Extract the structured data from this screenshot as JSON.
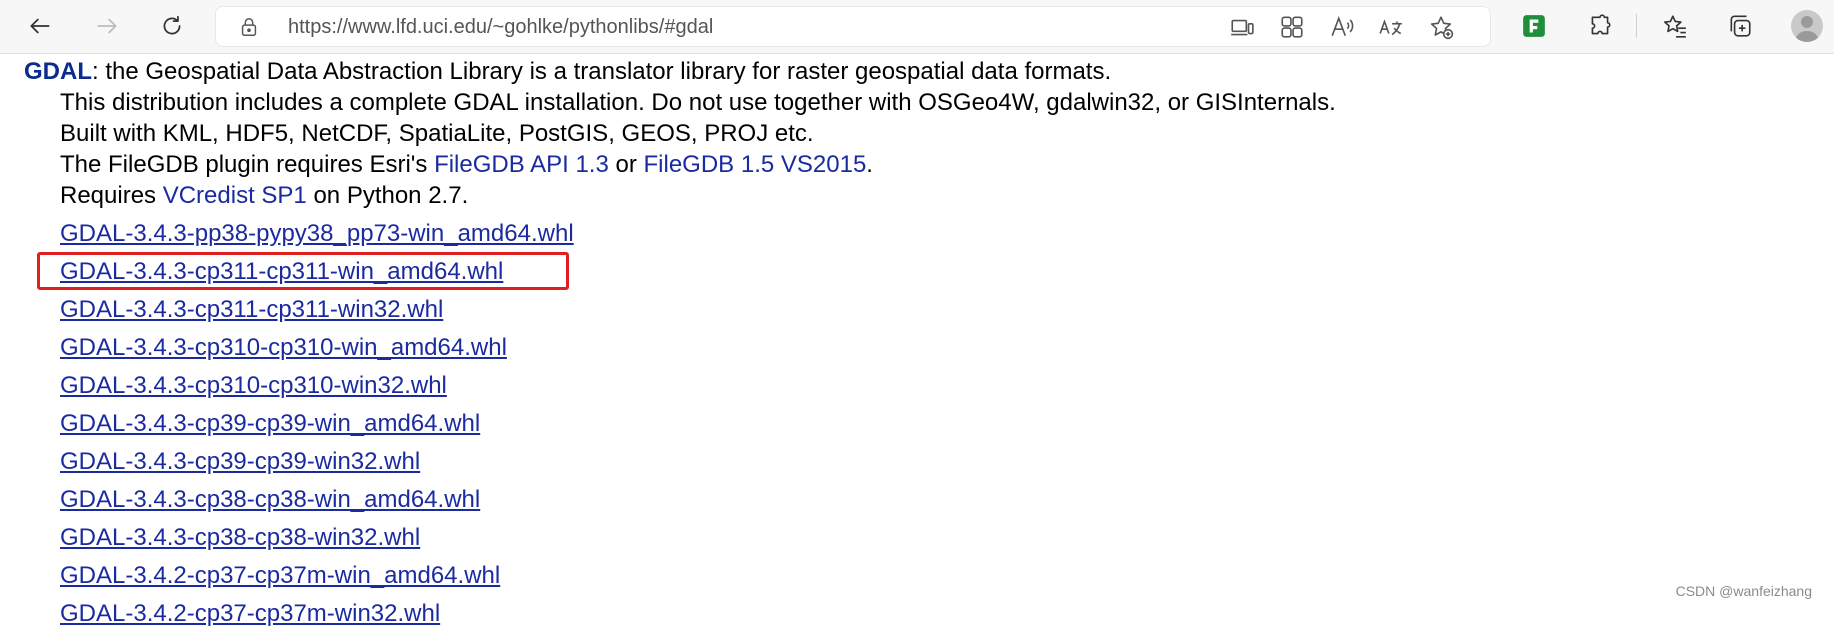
{
  "browser": {
    "url": "https://www.lfd.uci.edu/~gohlke/pythonlibs/#gdal",
    "nav_icons": [
      "back-arrow-icon",
      "forward-arrow-icon",
      "refresh-icon",
      "lock-icon"
    ],
    "url_icons": [
      "device-icon",
      "apps-icon",
      "read-aloud-icon",
      "translate-icon",
      "add-favorite-icon"
    ],
    "toolbar_icons": [
      "extension-green-icon",
      "extensions-icon",
      "favorites-icon",
      "collections-icon",
      "profile-avatar-icon"
    ]
  },
  "page": {
    "brand": "GDAL",
    "intro_rest": ": the Geospatial Data Abstraction Library is a translator library for raster geospatial data formats.",
    "line2": "This distribution includes a complete GDAL installation. Do not use together with OSGeo4W, gdalwin32, or GISInternals.",
    "line3": "Built with KML, HDF5, NetCDF, SpatiaLite, PostGIS, GEOS, PROJ etc.",
    "line4_prefix": "The FileGDB plugin requires Esri's ",
    "line4_link1": "FileGDB API 1.3",
    "line4_mid": " or ",
    "line4_link2": "FileGDB 1.5 VS2015",
    "line4_suffix": ".",
    "line5_prefix": "Requires ",
    "line5_link": "VCredist SP1",
    "line5_suffix": " on Python 2.7.",
    "downloads": [
      "GDAL-3.4.3-pp38-pypy38_pp73-win_amd64.whl",
      "GDAL-3.4.3-cp311-cp311-win_amd64.whl",
      "GDAL-3.4.3-cp311-cp311-win32.whl",
      "GDAL-3.4.3-cp310-cp310-win_amd64.whl",
      "GDAL-3.4.3-cp310-cp310-win32.whl",
      "GDAL-3.4.3-cp39-cp39-win_amd64.whl",
      "GDAL-3.4.3-cp39-cp39-win32.whl",
      "GDAL-3.4.3-cp38-cp38-win_amd64.whl",
      "GDAL-3.4.3-cp38-cp38-win32.whl",
      "GDAL-3.4.2-cp37-cp37m-win_amd64.whl",
      "GDAL-3.4.2-cp37-cp37m-win32.whl"
    ],
    "highlighted_download": "GDAL-3.4.3-cp311-cp311-win_amd64.whl"
  },
  "watermark": "CSDN @wanfeizhang",
  "colors": {
    "link": "#1a2aa0",
    "brand": "#0b2b8e",
    "highlight": "#e02020",
    "toolbar_bg": "#f7f7f7"
  }
}
